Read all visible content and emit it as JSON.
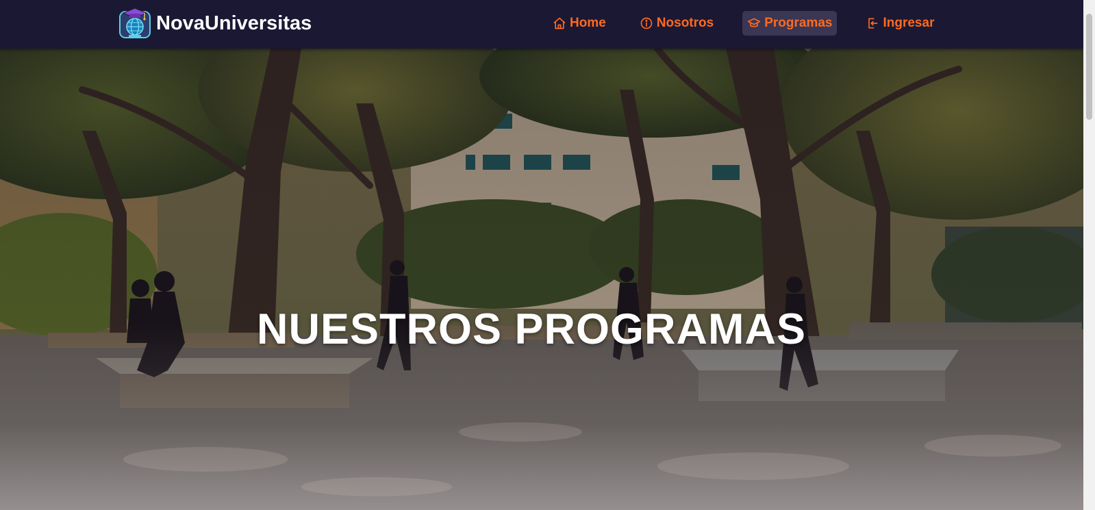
{
  "brand": {
    "name": "NovaUniversitas",
    "icon": "graduation-globe-logo"
  },
  "nav": {
    "items": [
      {
        "label": "Home",
        "icon": "home-icon",
        "active": false
      },
      {
        "label": "Nosotros",
        "icon": "info-icon",
        "active": false
      },
      {
        "label": "Programas",
        "icon": "graduation-cap-icon",
        "active": true
      },
      {
        "label": "Ingresar",
        "icon": "login-icon",
        "active": false
      }
    ]
  },
  "hero": {
    "title": "NUESTROS PROGRAMAS",
    "background": "campus-photo"
  },
  "colors": {
    "navbar_bg": "#1b1834",
    "accent": "#ff6a1f",
    "active_bg": "#3a3654",
    "title": "#ffffff"
  }
}
